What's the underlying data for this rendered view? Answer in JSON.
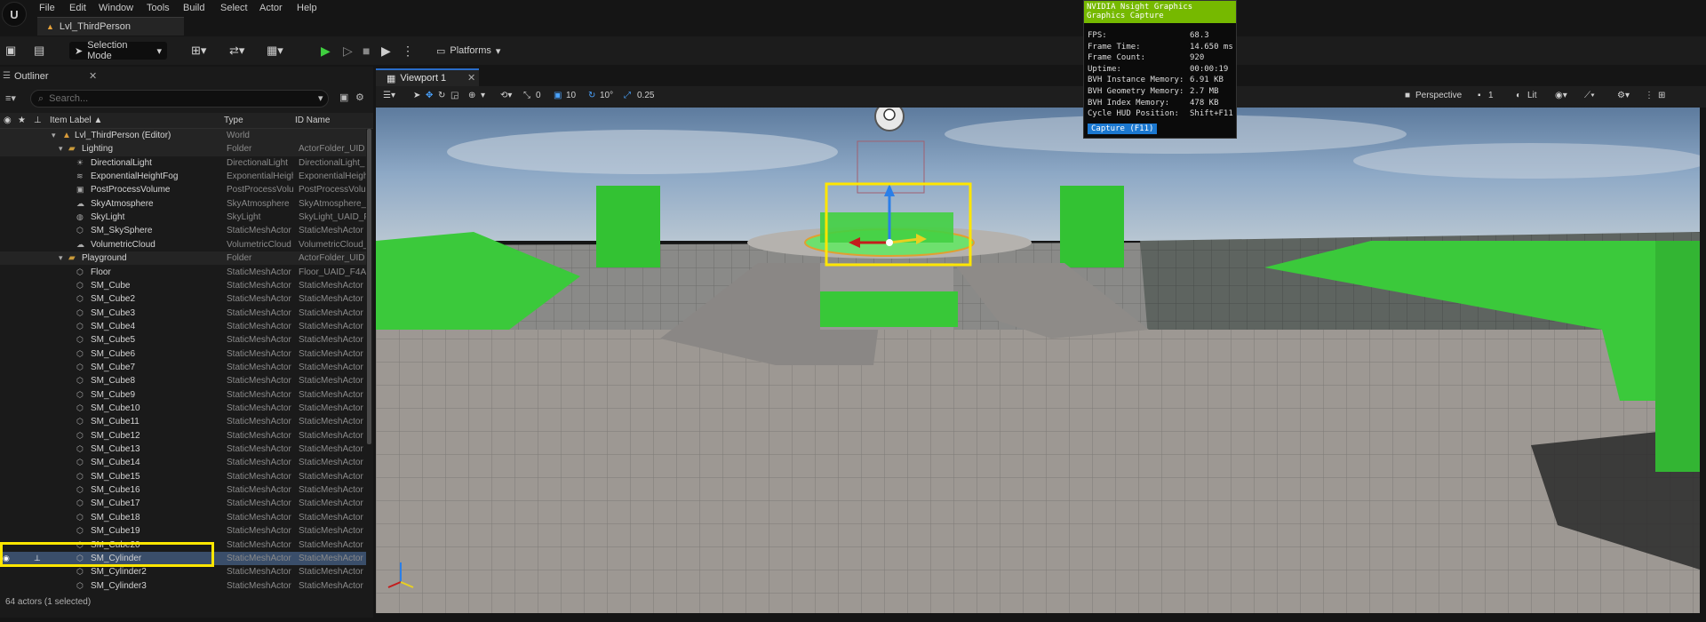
{
  "menu": [
    "File",
    "Edit",
    "Window",
    "Tools",
    "Build",
    "Select",
    "Actor",
    "Help"
  ],
  "level_tab": "Lvl_ThirdPerson",
  "toolbar": {
    "mode": "Selection Mode",
    "platforms": "Platforms"
  },
  "outliner": {
    "tab": "Outliner",
    "search_placeholder": "Search...",
    "columns": {
      "label": "Item Label ▲",
      "type": "Type",
      "id": "ID Name"
    },
    "rows": [
      {
        "label": "Lvl_ThirdPerson (Editor)",
        "type": "World",
        "id": "",
        "kind": "world",
        "indent": 1
      },
      {
        "label": "Lighting",
        "type": "Folder",
        "id": "ActorFolder_UID",
        "kind": "folder",
        "indent": 2
      },
      {
        "label": "DirectionalLight",
        "type": "DirectionalLight",
        "id": "DirectionalLight_",
        "kind": "item",
        "icon": "sun"
      },
      {
        "label": "ExponentialHeightFog",
        "type": "ExponentialHeigh",
        "id": "ExponentialHeigh",
        "kind": "item",
        "icon": "fog"
      },
      {
        "label": "PostProcessVolume",
        "type": "PostProcessVolu",
        "id": "PostProcessVolu",
        "kind": "item",
        "icon": "volume"
      },
      {
        "label": "SkyAtmosphere",
        "type": "SkyAtmosphere",
        "id": "SkyAtmosphere_",
        "kind": "item",
        "icon": "sky"
      },
      {
        "label": "SkyLight",
        "type": "SkyLight",
        "id": "SkyLight_UAID_F",
        "kind": "item",
        "icon": "skylight"
      },
      {
        "label": "SM_SkySphere",
        "type": "StaticMeshActor",
        "id": "StaticMeshActor",
        "kind": "item",
        "icon": "mesh"
      },
      {
        "label": "VolumetricCloud",
        "type": "VolumetricCloud",
        "id": "VolumetricCloud_",
        "kind": "item",
        "icon": "cloud"
      },
      {
        "label": "Playground",
        "type": "Folder",
        "id": "ActorFolder_UID",
        "kind": "folder",
        "indent": 2
      },
      {
        "label": "Floor",
        "type": "StaticMeshActor",
        "id": "Floor_UAID_F4A",
        "kind": "item",
        "icon": "mesh"
      },
      {
        "label": "SM_Cube",
        "type": "StaticMeshActor",
        "id": "StaticMeshActor",
        "kind": "item",
        "icon": "mesh"
      },
      {
        "label": "SM_Cube2",
        "type": "StaticMeshActor",
        "id": "StaticMeshActor",
        "kind": "item",
        "icon": "mesh"
      },
      {
        "label": "SM_Cube3",
        "type": "StaticMeshActor",
        "id": "StaticMeshActor",
        "kind": "item",
        "icon": "mesh"
      },
      {
        "label": "SM_Cube4",
        "type": "StaticMeshActor",
        "id": "StaticMeshActor",
        "kind": "item",
        "icon": "mesh"
      },
      {
        "label": "SM_Cube5",
        "type": "StaticMeshActor",
        "id": "StaticMeshActor",
        "kind": "item",
        "icon": "mesh"
      },
      {
        "label": "SM_Cube6",
        "type": "StaticMeshActor",
        "id": "StaticMeshActor",
        "kind": "item",
        "icon": "mesh"
      },
      {
        "label": "SM_Cube7",
        "type": "StaticMeshActor",
        "id": "StaticMeshActor",
        "kind": "item",
        "icon": "mesh"
      },
      {
        "label": "SM_Cube8",
        "type": "StaticMeshActor",
        "id": "StaticMeshActor",
        "kind": "item",
        "icon": "mesh"
      },
      {
        "label": "SM_Cube9",
        "type": "StaticMeshActor",
        "id": "StaticMeshActor",
        "kind": "item",
        "icon": "mesh"
      },
      {
        "label": "SM_Cube10",
        "type": "StaticMeshActor",
        "id": "StaticMeshActor",
        "kind": "item",
        "icon": "mesh"
      },
      {
        "label": "SM_Cube11",
        "type": "StaticMeshActor",
        "id": "StaticMeshActor",
        "kind": "item",
        "icon": "mesh"
      },
      {
        "label": "SM_Cube12",
        "type": "StaticMeshActor",
        "id": "StaticMeshActor",
        "kind": "item",
        "icon": "mesh"
      },
      {
        "label": "SM_Cube13",
        "type": "StaticMeshActor",
        "id": "StaticMeshActor",
        "kind": "item",
        "icon": "mesh"
      },
      {
        "label": "SM_Cube14",
        "type": "StaticMeshActor",
        "id": "StaticMeshActor",
        "kind": "item",
        "icon": "mesh"
      },
      {
        "label": "SM_Cube15",
        "type": "StaticMeshActor",
        "id": "StaticMeshActor",
        "kind": "item",
        "icon": "mesh"
      },
      {
        "label": "SM_Cube16",
        "type": "StaticMeshActor",
        "id": "StaticMeshActor",
        "kind": "item",
        "icon": "mesh"
      },
      {
        "label": "SM_Cube17",
        "type": "StaticMeshActor",
        "id": "StaticMeshActor",
        "kind": "item",
        "icon": "mesh"
      },
      {
        "label": "SM_Cube18",
        "type": "StaticMeshActor",
        "id": "StaticMeshActor",
        "kind": "item",
        "icon": "mesh"
      },
      {
        "label": "SM_Cube19",
        "type": "StaticMeshActor",
        "id": "StaticMeshActor",
        "kind": "item",
        "icon": "mesh"
      },
      {
        "label": "SM_Cube20",
        "type": "StaticMeshActor",
        "id": "StaticMeshActor",
        "kind": "item",
        "icon": "mesh"
      },
      {
        "label": "SM_Cylinder",
        "type": "StaticMeshActor",
        "id": "StaticMeshActor",
        "kind": "selected",
        "icon": "mesh"
      },
      {
        "label": "SM_Cylinder2",
        "type": "StaticMeshActor",
        "id": "StaticMeshActor",
        "kind": "item",
        "icon": "mesh"
      },
      {
        "label": "SM_Cylinder3",
        "type": "StaticMeshActor",
        "id": "StaticMeshActor",
        "kind": "item",
        "icon": "mesh"
      }
    ],
    "status": "64 actors (1 selected)"
  },
  "viewport": {
    "tab": "Viewport 1",
    "toolbar": {
      "rot_snap": "0",
      "grid_snap": "10",
      "angle_snap": "10°",
      "scale_snap": "0.25",
      "perspective": "Perspective",
      "camera_speed": "1",
      "lit": "Lit"
    },
    "colors": {
      "sky": "#5f7a98",
      "green": "#3fcf3f",
      "floor": "#9a9590",
      "highlight": "#ffe600"
    }
  },
  "nsight": {
    "title1": "NVIDIA Nsight Graphics",
    "title2": "Graphics Capture",
    "stats": [
      {
        "k": "FPS:",
        "v": "68.3"
      },
      {
        "k": "Frame Time:",
        "v": "14.650 ms"
      },
      {
        "k": "Frame Count:",
        "v": "920"
      },
      {
        "k": "Uptime:",
        "v": "00:00:19"
      },
      {
        "k": "BVH Instance Memory:",
        "v": "6.91 KB"
      },
      {
        "k": "BVH Geometry Memory:",
        "v": "2.7 MB"
      },
      {
        "k": "BVH Index Memory:",
        "v": "478 KB"
      },
      {
        "k": "Cycle HUD Position:",
        "v": "Shift+F11"
      }
    ],
    "capture": "Capture (F11)"
  }
}
